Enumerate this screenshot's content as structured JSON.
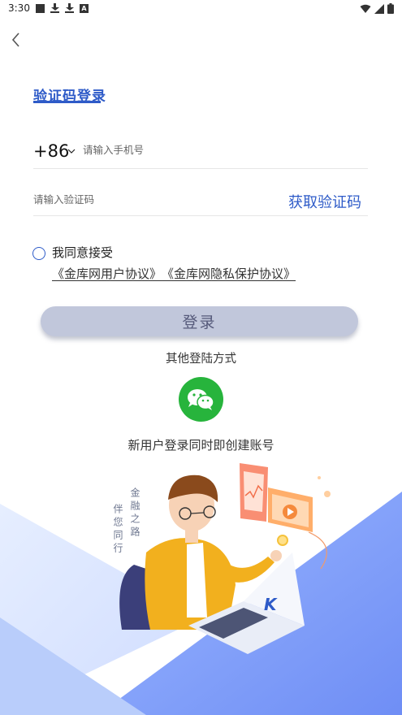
{
  "status_bar": {
    "time": "3:30",
    "badge_letter": "A"
  },
  "title": "验证码登录",
  "phone": {
    "country_code": "+86",
    "placeholder": "请输入手机号"
  },
  "code": {
    "placeholder": "请输入验证码",
    "get_code_label": "获取验证码"
  },
  "agreement": {
    "text": "我同意接受",
    "user_agreement": "《金库网用户协议》",
    "privacy_agreement": "《金库网隐私保护协议》"
  },
  "login_label": "登录",
  "other_login_label": "其他登陆方式",
  "new_user_note": "新用户登录同时即创建账号",
  "illustration": {
    "slogan_line1": "金融之路",
    "slogan_line2": "伴您同行",
    "laptop_logo": "K"
  },
  "colors": {
    "accent": "#2e5bc8",
    "wechat": "#27b43c",
    "button": "#c1c7db"
  },
  "icons": [
    "back-chevron-icon",
    "chevron-down-icon",
    "wechat-icon",
    "wifi-icon",
    "signal-icon",
    "battery-icon"
  ]
}
